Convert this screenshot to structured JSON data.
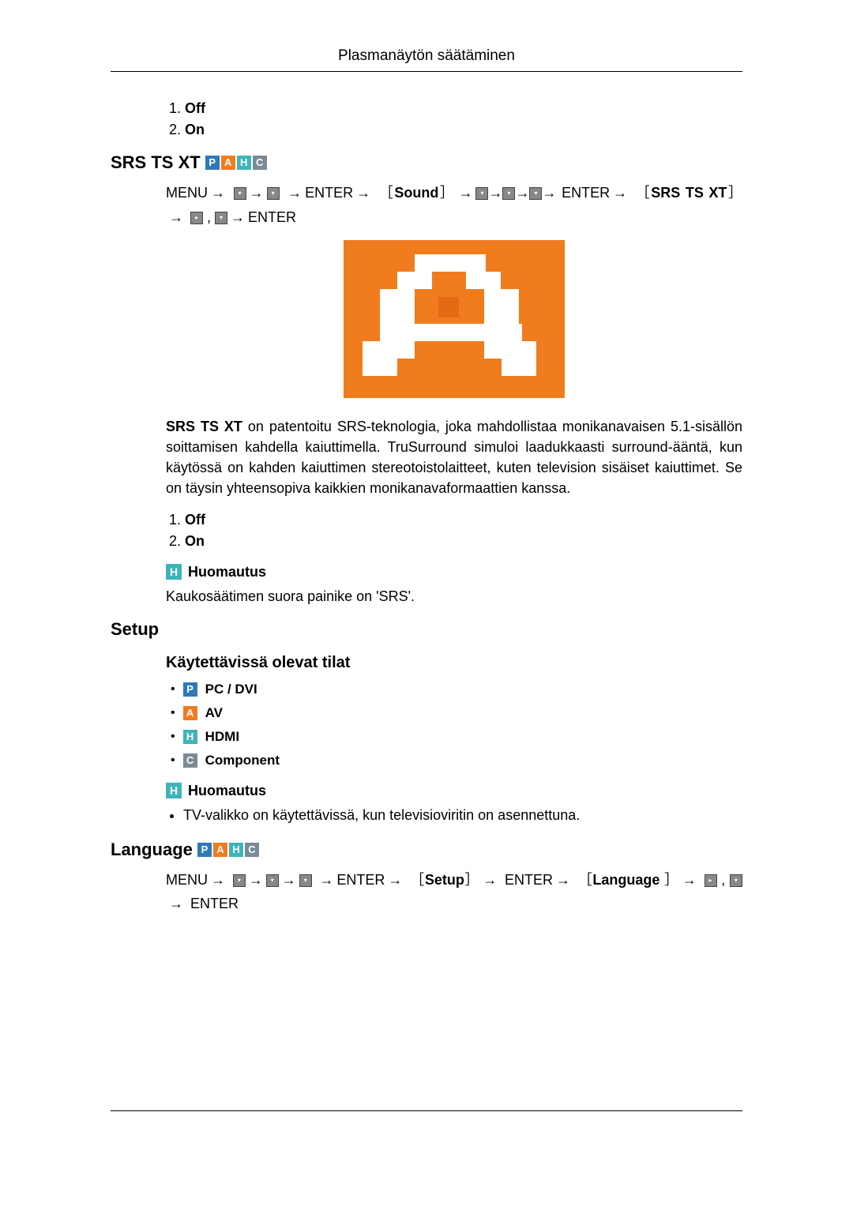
{
  "header": {
    "title": "Plasmanäytön säätäminen"
  },
  "first_list": {
    "item1": "Off",
    "item2": "On"
  },
  "srs": {
    "heading": "SRS TS XT",
    "badges": {
      "p": "P",
      "a": "A",
      "h": "H",
      "c": "C"
    },
    "nav": {
      "menu": "MENU",
      "enter": "ENTER",
      "sound": "Sound",
      "target": "SRS TS XT"
    },
    "description_lead": "SRS TS XT",
    "description_rest": " on patentoitu SRS-teknologia, joka mahdollistaa monikanavaisen 5.1-sisällön soittamisen kahdella kaiuttimella. TruSurround simuloi laadukkaasti surround-ääntä, kun käytössä on kahden kaiuttimen stereotoistolaitteet, kuten television sisäiset kaiuttimet. Se on täysin yhteensopiva kaikkien monikanavaformaattien kanssa.",
    "list": {
      "item1": "Off",
      "item2": "On"
    },
    "note_label": "Huomautus",
    "note_text": "Kaukosäätimen suora painike on 'SRS'."
  },
  "setup": {
    "heading": "Setup",
    "modes_heading": "Käytettävissä olevat tilat",
    "modes": {
      "pc": "PC / DVI",
      "av": "AV",
      "hdmi": "HDMI",
      "component": "Component"
    },
    "note_label": "Huomautus",
    "note_tv_bold": "TV",
    "note_tv_rest": "-valikko on käytettävissä, kun televisioviritin on asennettuna."
  },
  "language": {
    "heading": "Language",
    "badges": {
      "p": "P",
      "a": "A",
      "h": "H",
      "c": "C"
    },
    "nav": {
      "menu": "MENU",
      "enter": "ENTER",
      "setup": "Setup",
      "target": "Language "
    }
  }
}
